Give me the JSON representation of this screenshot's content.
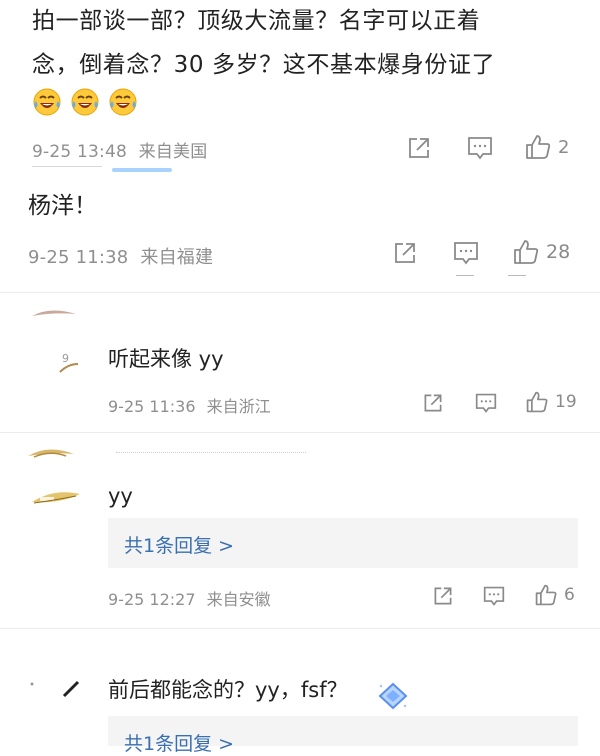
{
  "comment1": {
    "text_line1": "拍一部谈一部？顶级大流量？名字可以正着",
    "text_line2": "念，倒着念？30 多岁？这不基本爆身份证了",
    "emoji_count": 3,
    "emoji_icon": "laugh-cry-emoji",
    "time": "9-25 13:48",
    "location": "来自美国",
    "likes": "2",
    "icons": [
      "share-icon",
      "comment-icon",
      "like-icon"
    ]
  },
  "comment2": {
    "text": "杨洋！",
    "time": "9-25 11:38",
    "location": "来自福建",
    "likes": "28"
  },
  "comment3": {
    "text": "听起来像 yy",
    "time": "9-25 11:36",
    "location": "来自浙江",
    "likes": "19"
  },
  "comment4": {
    "text": "yy",
    "reply_link": "共1条回复 >",
    "time": "9-25 12:27",
    "location": "来自安徽",
    "likes": "6"
  },
  "comment5": {
    "text": "前后都能念的？yy，fsf？",
    "badge_icon": "diamond-badge-icon",
    "reply_link": "共1条回复 >"
  },
  "colors": {
    "text": "#222222",
    "meta": "#8f8f8f",
    "link": "#3a6fb0",
    "reply_bg": "#f4f4f5"
  }
}
